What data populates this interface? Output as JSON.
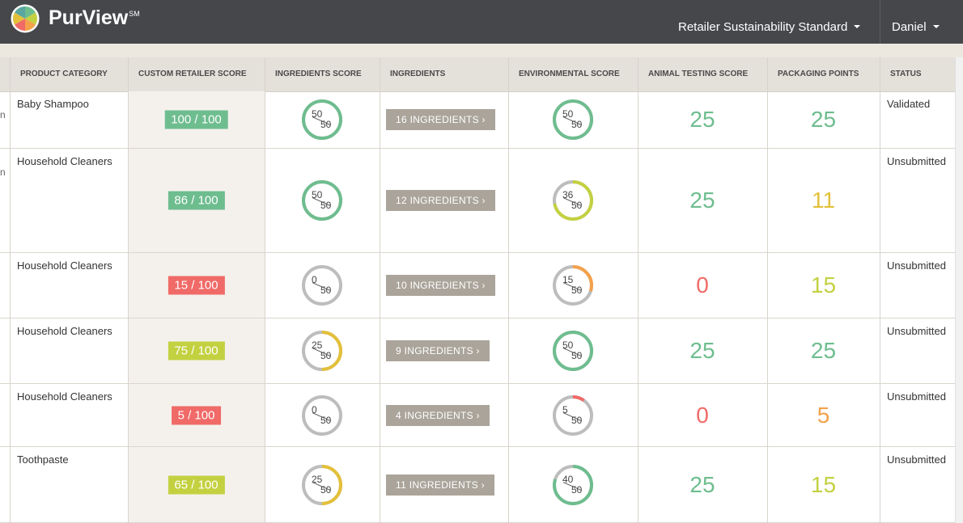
{
  "header": {
    "brand": "PurView",
    "brand_mark": "SM",
    "standard": "Retailer Sustainability Standard",
    "user": "Daniel"
  },
  "colors": {
    "green": "#6ebd8f",
    "yellow_green": "#c3d141",
    "red": "#f06a67",
    "orange": "#f4a14b",
    "yellow": "#e3c03a",
    "gray": "#bdbdbd"
  },
  "columns": [
    "PRODUCT CATEGORY",
    "CUSTOM RETAILER SCORE",
    "INGREDIENTS SCORE",
    "INGREDIENTS",
    "ENVIRONMENTAL SCORE",
    "ANIMAL TESTING SCORE",
    "PACKAGING POINTS",
    "STATUS"
  ],
  "rows": [
    {
      "stub": "n",
      "category": "Baby Shampoo",
      "retailer_score": "100 / 100",
      "retailer_color": "green",
      "ing_num": "50",
      "ing_den": "50",
      "ing_frac": 1.0,
      "ing_color": "green",
      "ingredients": "16 INGREDIENTS  ›",
      "env_num": "50",
      "env_den": "50",
      "env_frac": 1.0,
      "env_color": "green",
      "animal": "25",
      "animal_color": "green",
      "packaging": "25",
      "packaging_color": "green",
      "status": "Validated"
    },
    {
      "stub": "n",
      "category": "Household Cleaners",
      "retailer_score": "86 / 100",
      "retailer_color": "green",
      "ing_num": "50",
      "ing_den": "50",
      "ing_frac": 1.0,
      "ing_color": "green",
      "ingredients": "12 INGREDIENTS  ›",
      "env_num": "36",
      "env_den": "50",
      "env_frac": 0.72,
      "env_color": "yellow_green",
      "animal": "25",
      "animal_color": "green",
      "packaging": "11",
      "packaging_color": "yellow",
      "status": "Unsubmitted"
    },
    {
      "stub": "",
      "category": "Household Cleaners",
      "retailer_score": "15 / 100",
      "retailer_color": "red",
      "ing_num": "0",
      "ing_den": "50",
      "ing_frac": 0.0,
      "ing_color": "gray",
      "ingredients": "10 INGREDIENTS  ›",
      "env_num": "15",
      "env_den": "50",
      "env_frac": 0.3,
      "env_color": "orange",
      "animal": "0",
      "animal_color": "red",
      "packaging": "15",
      "packaging_color": "yellow_green",
      "status": "Unsubmitted"
    },
    {
      "stub": "",
      "category": "Household Cleaners",
      "retailer_score": "75 / 100",
      "retailer_color": "yellow_green",
      "ing_num": "25",
      "ing_den": "50",
      "ing_frac": 0.5,
      "ing_color": "yellow",
      "ingredients": "9 INGREDIENTS  ›",
      "env_num": "50",
      "env_den": "50",
      "env_frac": 1.0,
      "env_color": "green",
      "animal": "25",
      "animal_color": "green",
      "packaging": "25",
      "packaging_color": "green",
      "status": "Unsubmitted"
    },
    {
      "stub": "",
      "category": "Household Cleaners",
      "retailer_score": "5 / 100",
      "retailer_color": "red",
      "ing_num": "0",
      "ing_den": "50",
      "ing_frac": 0.0,
      "ing_color": "gray",
      "ingredients": "4 INGREDIENTS  ›",
      "env_num": "5",
      "env_den": "50",
      "env_frac": 0.1,
      "env_color": "red",
      "animal": "0",
      "animal_color": "red",
      "packaging": "5",
      "packaging_color": "orange",
      "status": "Unsubmitted"
    },
    {
      "stub": "",
      "category": "Toothpaste",
      "retailer_score": "65 / 100",
      "retailer_color": "yellow_green",
      "ing_num": "25",
      "ing_den": "50",
      "ing_frac": 0.5,
      "ing_color": "yellow",
      "ingredients": "11 INGREDIENTS  ›",
      "env_num": "40",
      "env_den": "50",
      "env_frac": 0.8,
      "env_color": "green",
      "animal": "25",
      "animal_color": "green",
      "packaging": "15",
      "packaging_color": "yellow_green",
      "status": "Unsubmitted"
    }
  ]
}
